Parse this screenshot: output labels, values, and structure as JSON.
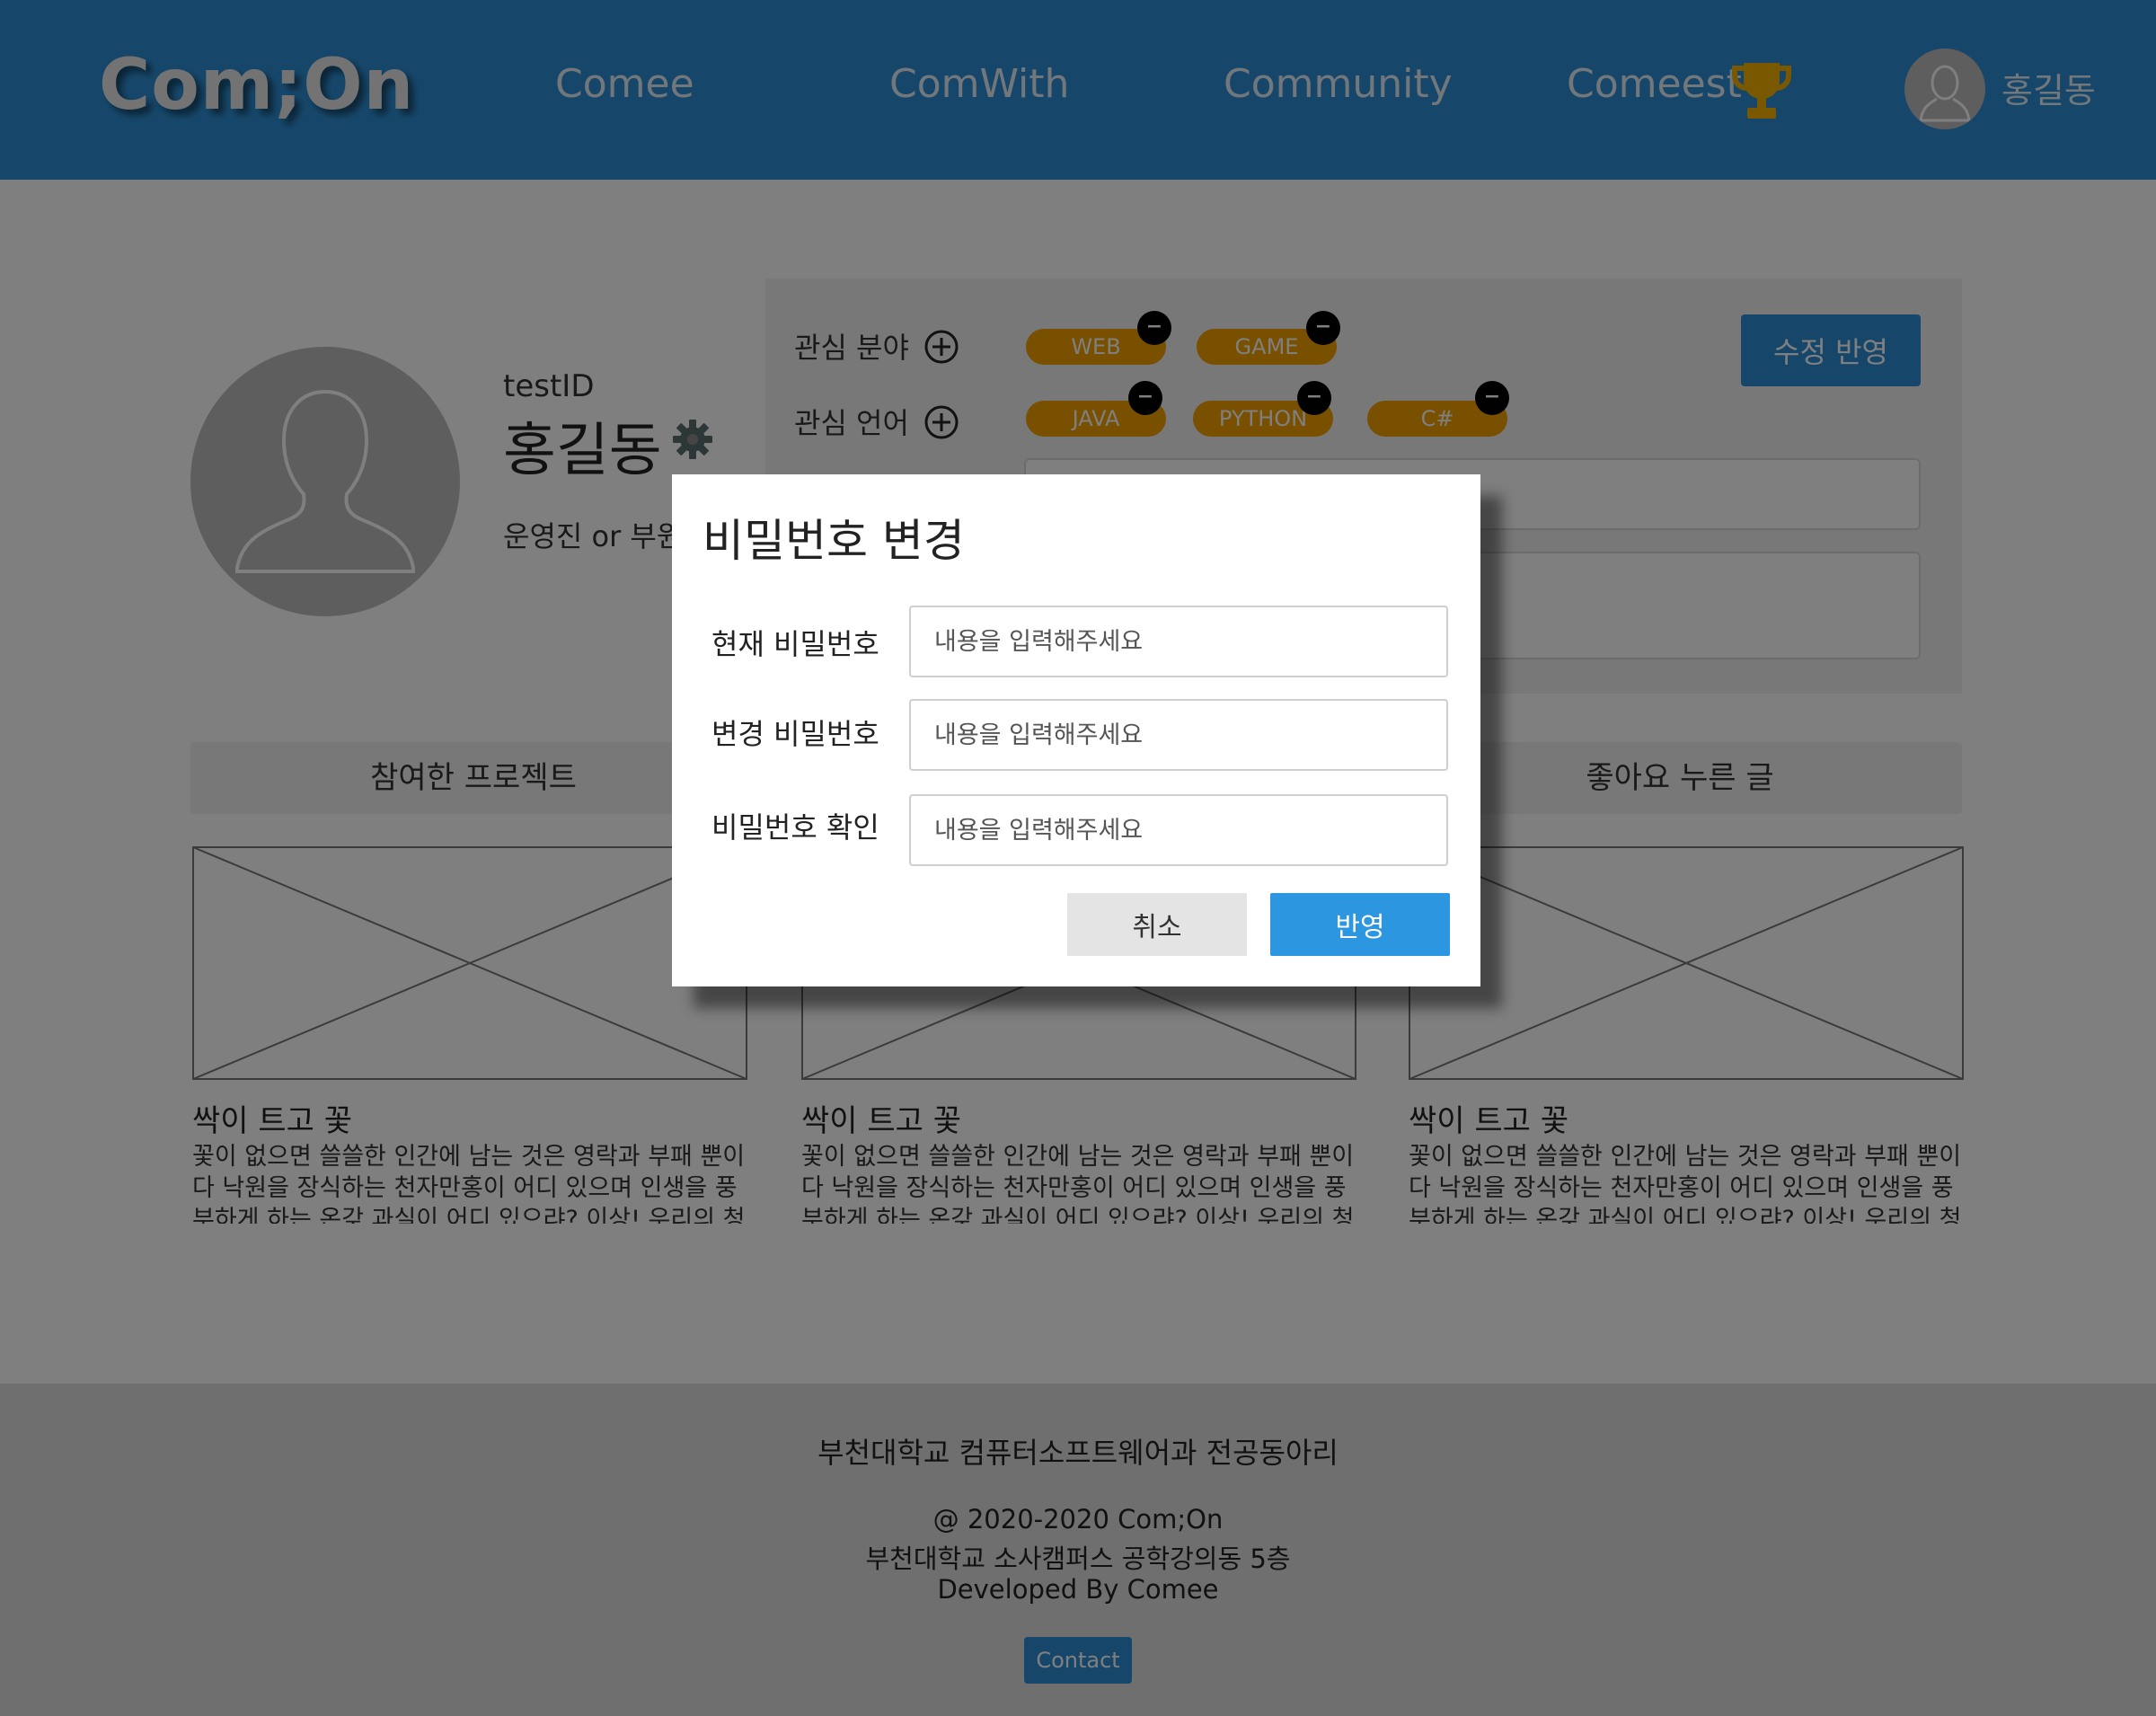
{
  "header": {
    "logo": "Com;On",
    "nav": [
      "Comee",
      "ComWith",
      "Community",
      "Comeest"
    ],
    "user_name": "홍길동"
  },
  "profile": {
    "id": "testID",
    "name": "홍길동",
    "role": "운영진 or 부원",
    "interest_field_label": "관심 분야",
    "interest_lang_label": "관심 언어",
    "field_tags": [
      "WEB",
      "GAME"
    ],
    "lang_tags": [
      "JAVA",
      "PYTHON",
      "C#"
    ],
    "save_label": "수정 반영",
    "tag_remove_symbol": "−"
  },
  "tabs": [
    "참여한 프로젝트",
    "좋아요 누른 글"
  ],
  "cards": [
    {
      "title": "싹이 트고 꽃",
      "text": "꽃이 없으면 쓸쓸한 인간에 남는 것은 영락과 부패 뿐이다 낙원을 장식하는 천자만홍이 어디 있으며 인생을 풍부하게 하는 온갖 과실이 어디 있으랴? 이상! 우리의 청춘이 가장"
    },
    {
      "title": "싹이 트고 꽃",
      "text": "꽃이 없으면 쓸쓸한 인간에 남는 것은 영락과 부패 뿐이다 낙원을 장식하는 천자만홍이 어디 있으며 인생을 풍부하게 하는 온갖 과실이 어디 있으랴? 이상! 우리의 청춘이 가장"
    },
    {
      "title": "싹이 트고 꽃",
      "text": "꽃이 없으면 쓸쓸한 인간에 남는 것은 영락과 부패 뿐이다 낙원을 장식하는 천자만홍이 어디 있으며 인생을 풍부하게 하는 온갖 과실이 어디 있으랴? 이상! 우리의 청춘이 가장"
    }
  ],
  "footer": {
    "org": "부천대학교 컴퓨터소프트웨어과 전공동아리",
    "copyright": "@ 2020-2020 Com;On",
    "address": "부천대학교 소사캠퍼스 공학강의동 5층",
    "developer": "Developed By Comee",
    "contact": "Contact"
  },
  "modal": {
    "title": "비밀번호 변경",
    "fields": [
      {
        "label": "현재 비밀번호",
        "value": "",
        "placeholder": "내용을 입력해주세요"
      },
      {
        "label": "변경 비밀번호",
        "value": "",
        "placeholder": "내용을 입력해주세요"
      },
      {
        "label": "비밀번호 확인",
        "value": "",
        "placeholder": "내용을 입력해주세요"
      }
    ],
    "cancel_label": "취소",
    "apply_label": "반영"
  },
  "colors": {
    "primary": "#2d8fd5",
    "tag": "#f0a000",
    "trophy": "#f2b100",
    "overlay": "rgba(0,0,0,0.5)"
  },
  "icons": {
    "trophy": "trophy-icon",
    "avatar": "user-silhouette-icon",
    "settings": "gear-icon",
    "add": "plus-circle-icon",
    "remove": "minus-circle-icon",
    "thumbnail": "image-placeholder-icon"
  }
}
